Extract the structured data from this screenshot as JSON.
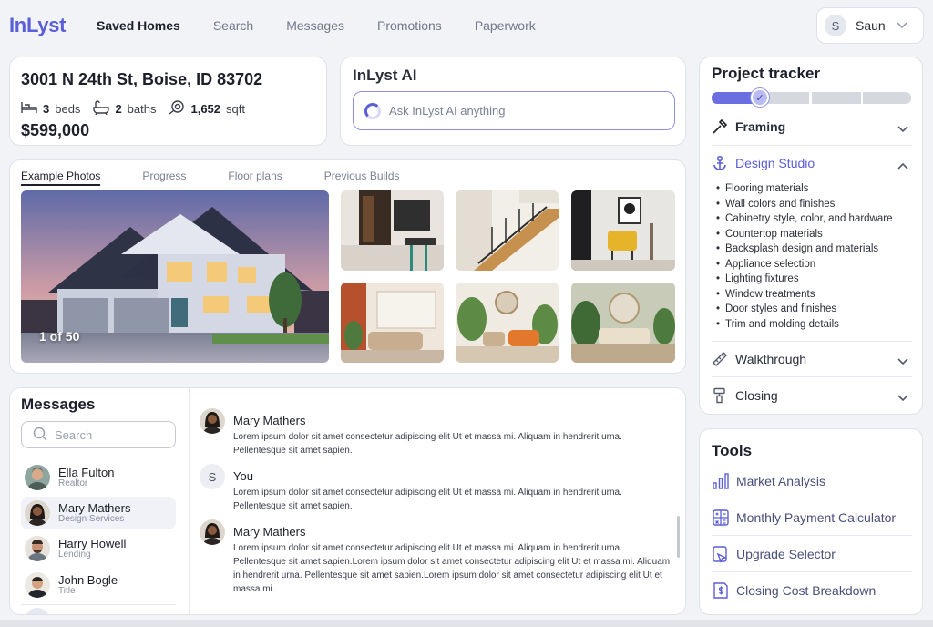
{
  "app": {
    "logo": "InLyst",
    "nav": [
      "Saved Homes",
      "Search",
      "Messages",
      "Promotions",
      "Paperwork"
    ],
    "user": {
      "initial": "S",
      "name": "Saun"
    }
  },
  "property": {
    "address": "3001 N 24th St, Boise, ID 83702",
    "beds": "3",
    "beds_label": "beds",
    "baths": "2",
    "baths_label": "baths",
    "sqft": "1,652",
    "sqft_label": "sqft",
    "price": "$599,000"
  },
  "ai": {
    "title": "InLyst AI",
    "placeholder": "Ask InLyst AI anything"
  },
  "photos": {
    "tabs": [
      "Example Photos",
      "Progress",
      "Floor plans",
      "Previous Builds"
    ],
    "counter": "1 of 50"
  },
  "messages": {
    "title": "Messages",
    "search_placeholder": "Search",
    "contacts": [
      {
        "name": "Ella Fulton",
        "role": "Realtor"
      },
      {
        "name": "Mary Mathers",
        "role": "Design Services"
      },
      {
        "name": "Harry Howell",
        "role": "Lending"
      },
      {
        "name": "John Bogle",
        "role": "Title"
      }
    ],
    "thread": [
      {
        "sender": "Mary Mathers",
        "body": "Lorem ipsum dolor sit amet consectetur adipiscing elit Ut et massa mi. Aliquam in hendrerit urna. Pellentesque sit amet sapien."
      },
      {
        "sender": "You",
        "initial": "S",
        "body": "Lorem ipsum dolor sit amet consectetur adipiscing elit Ut et massa mi. Aliquam in hendrerit urna. Pellentesque sit amet sapien."
      },
      {
        "sender": "Mary Mathers",
        "body": "Lorem ipsum dolor sit amet consectetur adipiscing elit Ut et massa mi. Aliquam in hendrerit urna. Pellentesque sit amet sapien.Lorem ipsum dolor sit amet consectetur adipiscing elit Ut et massa mi. Aliquam in hendrerit urna. Pellentesque sit amet sapien.Lorem ipsum dolor sit amet consectetur adipiscing elit Ut et massa mi."
      }
    ]
  },
  "tracker": {
    "title": "Project tracker",
    "progress": 0.25,
    "stages": [
      "Framing",
      "Design Studio",
      "Walkthrough",
      "Closing"
    ],
    "design_items": [
      "Flooring materials",
      "Wall colors and finishes",
      "Cabinetry style, color, and hardware",
      "Countertop materials",
      "Backsplash design and materials",
      "Appliance selection",
      "Lighting fixtures",
      "Window treatments",
      "Door styles and finishes",
      "Trim and molding details"
    ]
  },
  "tools": {
    "title": "Tools",
    "items": [
      "Market Analysis",
      "Monthly Payment Calculator",
      "Upgrade Selector",
      "Closing Cost Breakdown"
    ]
  },
  "colors": {
    "accent": "#5b5fd6",
    "text": "#1d1f2b",
    "muted": "#7b8092"
  }
}
